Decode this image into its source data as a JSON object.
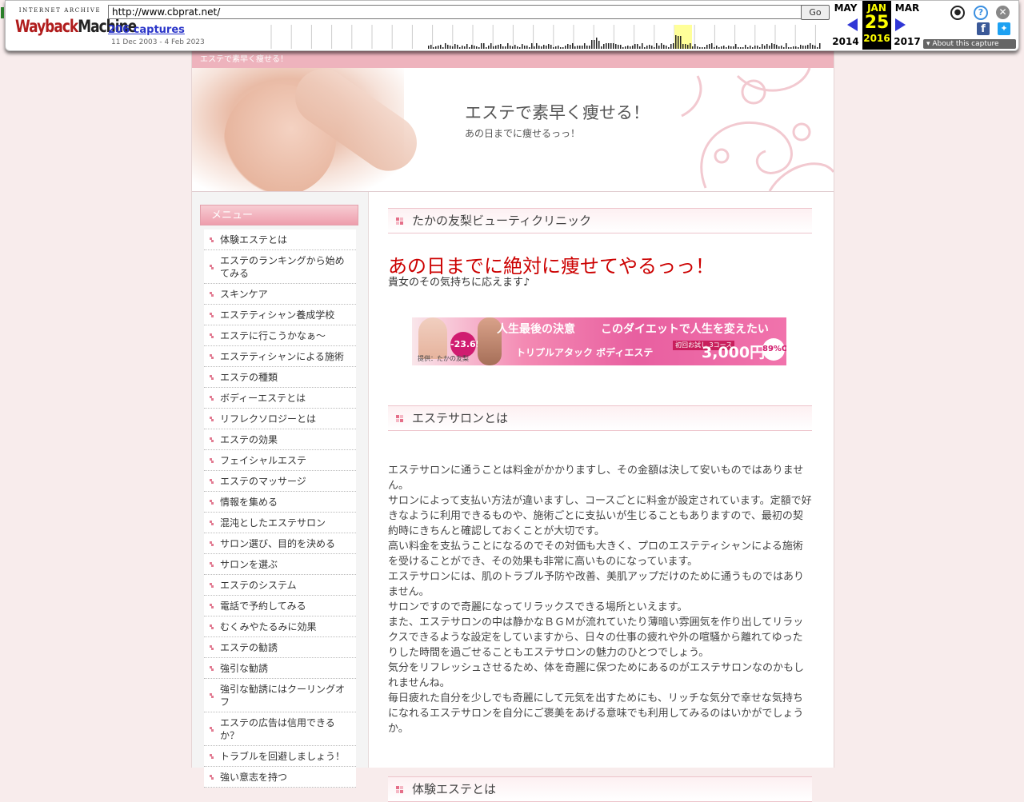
{
  "wayback": {
    "logo_top": "INTERNET ARCHIVE",
    "logo_red": "Wayback",
    "logo_black": "Machine",
    "url": "http://www.cbprat.net/",
    "go_label": "Go",
    "captures": "206 captures",
    "range": "11 Dec 2003 - 4 Feb 2023",
    "prev_month": "MAY",
    "prev_year": "2014",
    "cur_month": "JAN",
    "cur_day": "25",
    "cur_year": "2016",
    "next_month": "MAR",
    "next_year": "2017",
    "about": "About this capture"
  },
  "site": {
    "topbar": "エステで素早く痩せる！",
    "title": "エステで素早く痩せる！",
    "subtitle": "あの日までに痩せるっっ！"
  },
  "sidebar": {
    "heading": "メニュー",
    "items": [
      "体験エステとは",
      "エステのランキングから始めてみる",
      "スキンケア",
      "エステティシャン養成学校",
      "エステに行こうかなぁ～",
      "エステティシャンによる施術",
      "エステの種類",
      "ボディーエステとは",
      "リフレクソロジーとは",
      "エステの効果",
      "フェイシャルエステ",
      "エステのマッサージ",
      "情報を集める",
      "混沌としたエステサロン",
      "サロン選び、目的を決める",
      "サロンを選ぶ",
      "エステのシステム",
      "電話で予約してみる",
      "むくみやたるみに効果",
      "エステの勧誘",
      "強引な勧誘",
      "強引な勧誘にはクーリングオフ",
      "エステの広告は信用できるか？",
      "トラブルを回避しましょう！",
      "強い意志を持つ"
    ]
  },
  "main": {
    "section1_title": "たかの友梨ビューティクリニック",
    "headline": "あの日までに絶対に痩せてやるっっ！",
    "headline_sub": "貴女のその気持ちに応えます♪",
    "banner": {
      "badge": "-23.65kg",
      "text1": "人生最後の決意",
      "text2": "このダイエットで人生を変えたい",
      "text3": "トリプルアタック ボディエステ",
      "trial": "初回お試し 3コース",
      "price": "3,000円",
      "off": "89%OFF",
      "provider": "提供：たかの友梨"
    },
    "section2_title": "エステサロンとは",
    "paragraph": "エステサロンに通うことは料金がかかりますし、その金額は決して安いものではありません。\nサロンによって支払い方法が違いますし、コースごとに料金が設定されています。定額で好きなように利用できるものや、施術ごとに支払いが生じることもありますので、最初の契約時にきちんと確認しておくことが大切です。\n高い料金を支払うことになるのでその対価も大きく、プロのエステティシャンによる施術を受けることができ、その効果も非常に高いものになっています。\nエステサロンには、肌のトラブル予防や改善、美肌アップだけのために通うものではありません。\nサロンですので奇麗になってリラックスできる場所といえます。\nまた、エステサロンの中は静かなＢＧＭが流れていたり薄暗い雰囲気を作り出してリラックスできるような設定をしていますから、日々の仕事の疲れや外の喧騒から離れてゆったりした時間を過ごせることもエステサロンの魅力のひとつでしょう。\n気分をリフレッシュさせるため、体を奇麗に保つためにあるのがエステサロンなのかもしれませんね。\n毎日疲れた自分を少しでも奇麗にして元気を出すためにも、リッチな気分で幸せな気持ちになれるエステサロンを自分にご褒美をあげる意味でも利用してみるのはいかがでしょうか。",
    "section3_title": "体験エステとは"
  },
  "colors": {
    "accent_pink": "#eeb3bd",
    "headline_red": "#cc0000",
    "link_blue": "#2a35c9"
  }
}
